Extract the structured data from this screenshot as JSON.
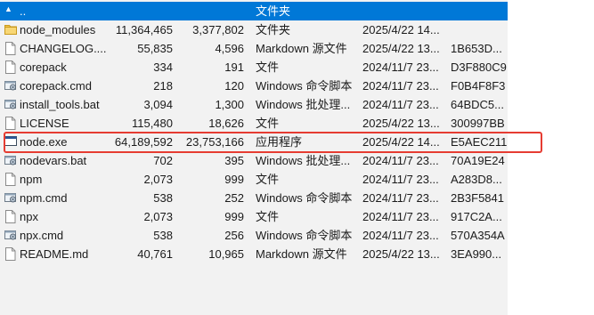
{
  "parent_row": {
    "name": "..",
    "type": "文件夹"
  },
  "files": [
    {
      "name": "node_modules",
      "size": "11,364,465",
      "packed": "3,377,802",
      "type": "文件夹",
      "modified": "2025/4/22 14...",
      "crc": "",
      "icon": "folder-icon"
    },
    {
      "name": "CHANGELOG....",
      "size": "55,835",
      "packed": "4,596",
      "type": "Markdown 源文件",
      "modified": "2025/4/22 13...",
      "crc": "1B653D...",
      "icon": "file-icon"
    },
    {
      "name": "corepack",
      "size": "334",
      "packed": "191",
      "type": "文件",
      "modified": "2024/11/7 23...",
      "crc": "D3F880C9",
      "icon": "file-icon"
    },
    {
      "name": "corepack.cmd",
      "size": "218",
      "packed": "120",
      "type": "Windows 命令脚本",
      "modified": "2024/11/7 23...",
      "crc": "F0B4F8F3",
      "icon": "script-icon"
    },
    {
      "name": "install_tools.bat",
      "size": "3,094",
      "packed": "1,300",
      "type": "Windows 批处理...",
      "modified": "2024/11/7 23...",
      "crc": "64BDC5...",
      "icon": "script-icon"
    },
    {
      "name": "LICENSE",
      "size": "115,480",
      "packed": "18,626",
      "type": "文件",
      "modified": "2025/4/22 13...",
      "crc": "300997BB",
      "icon": "file-icon"
    },
    {
      "name": "node.exe",
      "size": "64,189,592",
      "packed": "23,753,166",
      "type": "应用程序",
      "modified": "2025/4/22 14...",
      "crc": "E5AEC211",
      "icon": "exe-icon"
    },
    {
      "name": "nodevars.bat",
      "size": "702",
      "packed": "395",
      "type": "Windows 批处理...",
      "modified": "2024/11/7 23...",
      "crc": "70A19E24",
      "icon": "script-icon"
    },
    {
      "name": "npm",
      "size": "2,073",
      "packed": "999",
      "type": "文件",
      "modified": "2024/11/7 23...",
      "crc": "A283D8...",
      "icon": "file-icon"
    },
    {
      "name": "npm.cmd",
      "size": "538",
      "packed": "252",
      "type": "Windows 命令脚本",
      "modified": "2024/11/7 23...",
      "crc": "2B3F5841",
      "icon": "script-icon"
    },
    {
      "name": "npx",
      "size": "2,073",
      "packed": "999",
      "type": "文件",
      "modified": "2024/11/7 23...",
      "crc": "917C2A...",
      "icon": "file-icon"
    },
    {
      "name": "npx.cmd",
      "size": "538",
      "packed": "256",
      "type": "Windows 命令脚本",
      "modified": "2024/11/7 23...",
      "crc": "570A354A",
      "icon": "script-icon"
    },
    {
      "name": "README.md",
      "size": "40,761",
      "packed": "10,965",
      "type": "Markdown 源文件",
      "modified": "2025/4/22 13...",
      "crc": "3EA990...",
      "icon": "file-icon"
    }
  ],
  "colors": {
    "selection": "#0078d7",
    "highlight_border": "#e63c32",
    "folder": "#f4c64a"
  }
}
